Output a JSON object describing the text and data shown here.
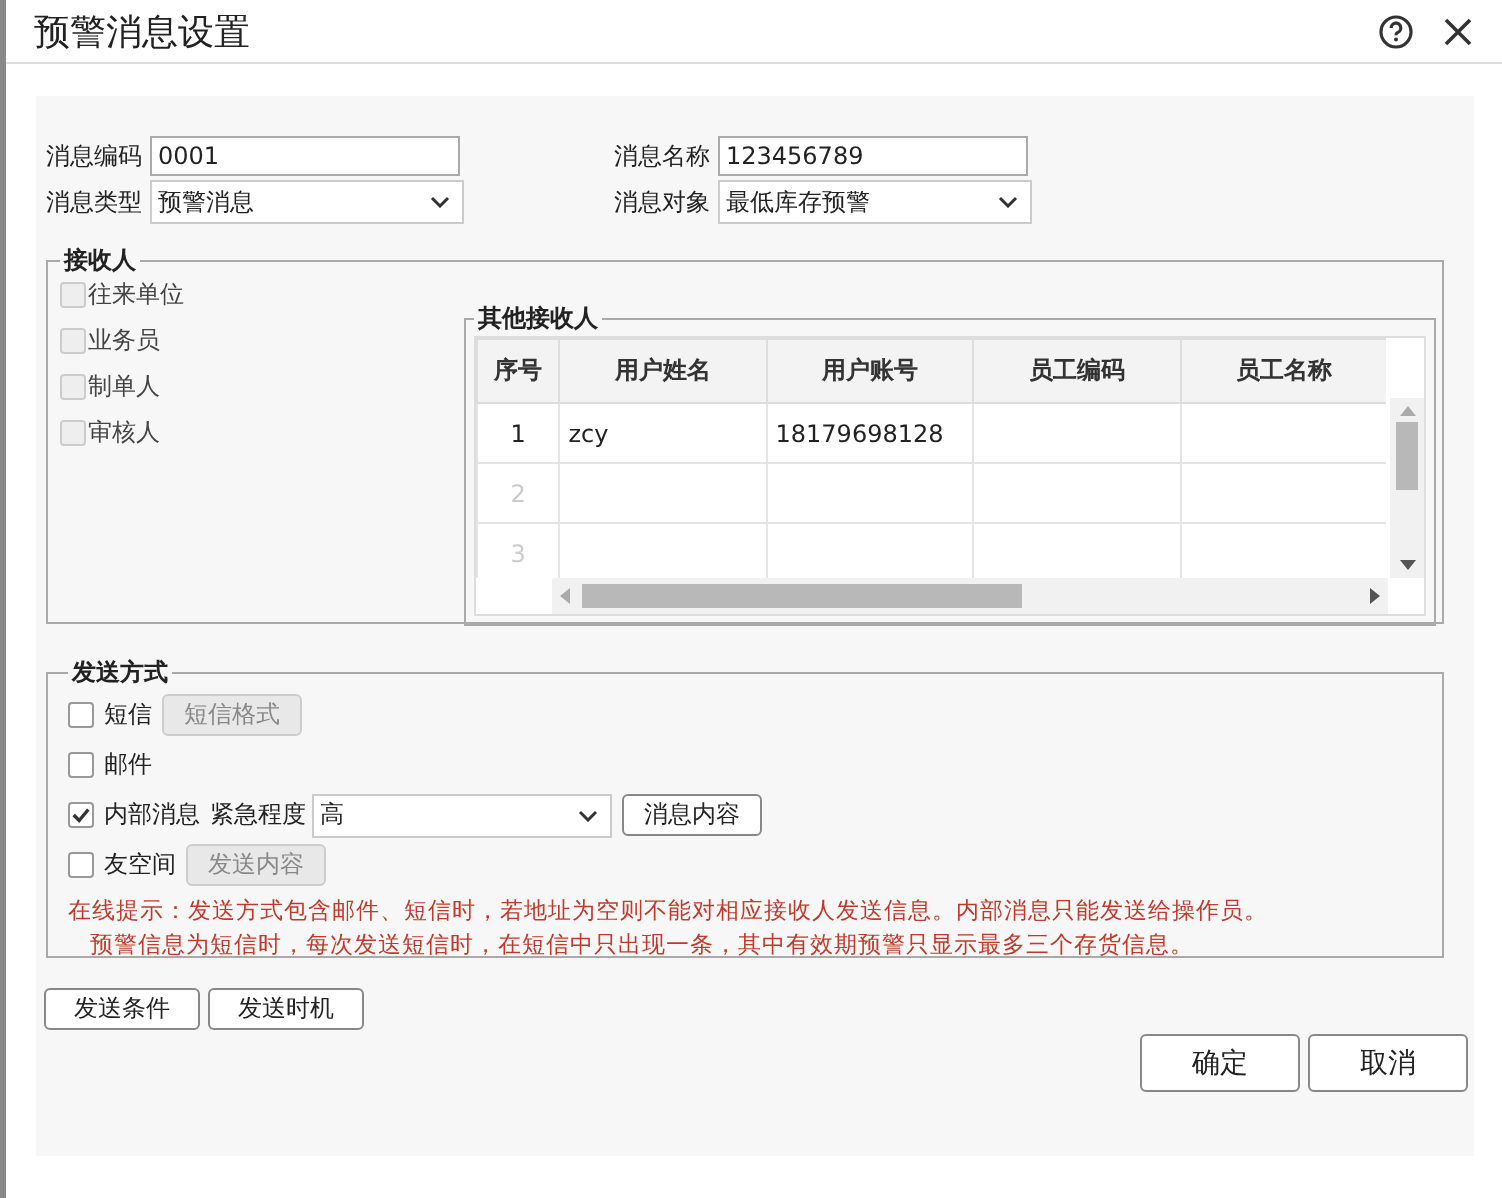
{
  "window": {
    "title": "预警消息设置"
  },
  "fields": [
    {
      "label": "消息编码",
      "kind": "text",
      "value": "0001"
    },
    {
      "label": "消息名称",
      "kind": "text",
      "value": "123456789"
    },
    {
      "label": "消息类型",
      "kind": "select",
      "value": "预警消息"
    },
    {
      "label": "消息对象",
      "kind": "select",
      "value": "最低库存预警"
    }
  ],
  "recipients": {
    "title": "接收人",
    "options": [
      {
        "label": "往来单位",
        "checked": false,
        "disabled": true
      },
      {
        "label": "业务员",
        "checked": false,
        "disabled": true
      },
      {
        "label": "制单人",
        "checked": false,
        "disabled": true
      },
      {
        "label": "审核人",
        "checked": false,
        "disabled": true
      }
    ],
    "others": {
      "title": "其他接收人",
      "columns": [
        "序号",
        "用户姓名",
        "用户账号",
        "员工编码",
        "员工名称"
      ],
      "rows": [
        {
          "filled": true,
          "cells": [
            "1",
            "zcy",
            "18179698128",
            "",
            ""
          ]
        },
        {
          "filled": false,
          "cells": [
            "2",
            "",
            "",
            "",
            ""
          ]
        },
        {
          "filled": false,
          "cells": [
            "3",
            "",
            "",
            "",
            ""
          ]
        }
      ]
    }
  },
  "send": {
    "title": "发送方式",
    "methods": [
      {
        "kind": "button",
        "label": "短信",
        "checked": false,
        "button": "短信格式",
        "button_disabled": true
      },
      {
        "kind": "plain",
        "label": "邮件",
        "checked": false
      },
      {
        "kind": "urgency",
        "label": "内部消息",
        "checked": true,
        "urgency_label": "紧急程度",
        "urgency_value": "高",
        "button": "消息内容",
        "button_disabled": false
      },
      {
        "kind": "button",
        "label": "友空间",
        "checked": false,
        "button": "发送内容",
        "button_disabled": true
      }
    ],
    "tips": [
      "在线提示：发送方式包含邮件、短信时，若地址为空则不能对相应接收人发送信息。内部消息只能发送给操作员。",
      "预警信息为短信时，每次发送短信时，在短信中只出现一条，其中有效期预警只显示最多三个存货信息。"
    ]
  },
  "extra_buttons": [
    "发送条件",
    "发送时机"
  ],
  "footer_buttons": [
    "确定",
    "取消"
  ]
}
